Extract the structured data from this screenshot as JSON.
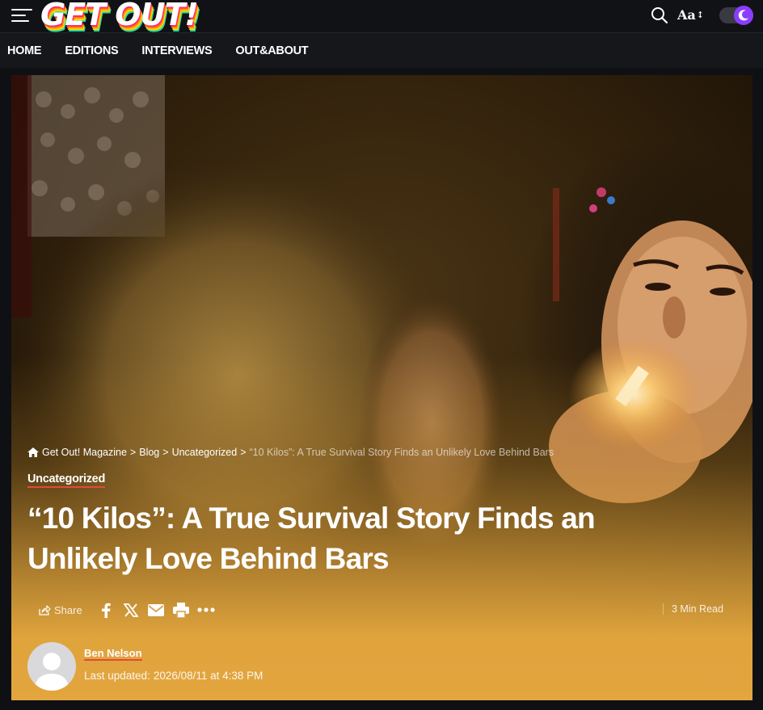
{
  "header": {
    "logo_text": "GET OUT!",
    "icons": [
      "menu-icon",
      "search-icon",
      "font-size-icon",
      "moon-icon"
    ],
    "font_toggle_label": "Aa",
    "font_toggle_arrow": "↕"
  },
  "nav": {
    "items": [
      {
        "label": "HOME"
      },
      {
        "label": "EDITIONS"
      },
      {
        "label": "INTERVIEWS"
      },
      {
        "label": "OUT&ABOUT"
      }
    ]
  },
  "article": {
    "breadcrumb": {
      "items": [
        "Get Out! Magazine",
        "Blog",
        "Uncategorized"
      ],
      "separator": ">",
      "current": "“10 Kilos”: A True Survival Story Finds an Unlikely Love Behind Bars"
    },
    "category": "Uncategorized",
    "title": "“10 Kilos”: A True Survival Story Finds an Unlikely Love Behind Bars",
    "share": {
      "label": "Share",
      "buttons": [
        "facebook-icon",
        "x-icon",
        "email-icon",
        "print-icon",
        "more-icon"
      ]
    },
    "read_time": "3 Min Read",
    "author": {
      "name": "Ben Nelson",
      "updated_label": "Last updated:",
      "updated_value": "2026/08/11 at 4:38 PM"
    }
  },
  "colors": {
    "hero_gradient_bottom": "#e3a53e",
    "accent_underline": "#e24a3a",
    "toggle_knob": "#8b3dff",
    "nav_bg": "#16171b"
  }
}
